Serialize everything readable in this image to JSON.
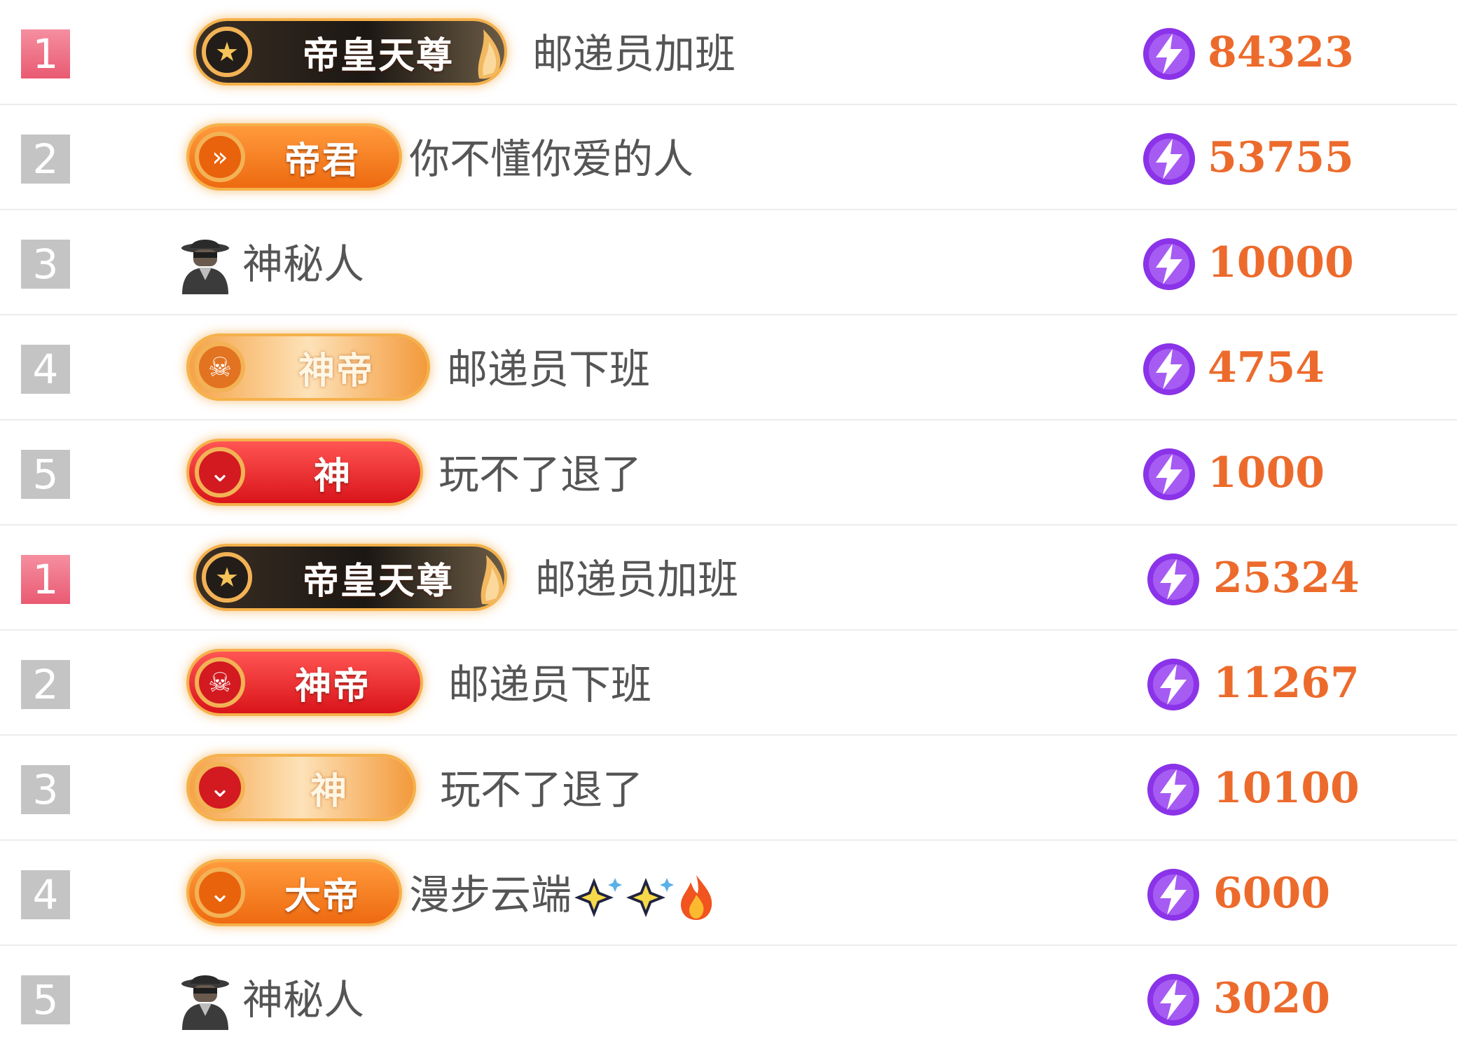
{
  "colors": {
    "rank_top": "#e95a72",
    "rank_other": "#c4c4c4",
    "score": "#ec6b2c",
    "bolt": "#8a33e8",
    "name": "#555555"
  },
  "rows": [
    {
      "rank": "1",
      "badge": {
        "style": "dark",
        "emblem_icon": "star-icon",
        "text": "帝皇天尊"
      },
      "name": "邮递员加班",
      "score": "84323"
    },
    {
      "rank": "2",
      "badge": {
        "style": "orange",
        "emblem_icon": "double-chevron-icon",
        "text": "帝君"
      },
      "name": "你不懂你爱的人",
      "score": "53755"
    },
    {
      "rank": "3",
      "badge": null,
      "avatar_icon": "mystery-person-icon",
      "name": "神秘人",
      "score": "10000"
    },
    {
      "rank": "4",
      "badge": {
        "style": "light",
        "emblem_icon": "skull-icon",
        "text": "神帝"
      },
      "name": "邮递员下班",
      "score": "4754"
    },
    {
      "rank": "5",
      "badge": {
        "style": "red",
        "emblem_icon": "chevron-down-icon",
        "text": "神"
      },
      "name": "玩不了退了",
      "score": "1000"
    },
    {
      "rank": "1",
      "badge": {
        "style": "dark",
        "emblem_icon": "star-icon",
        "text": "帝皇天尊"
      },
      "name": "邮递员加班",
      "score": "25324"
    },
    {
      "rank": "2",
      "badge": {
        "style": "red",
        "emblem_icon": "skull-icon",
        "text": "神帝"
      },
      "name": "邮递员下班",
      "score": "11267"
    },
    {
      "rank": "3",
      "badge": {
        "style": "light",
        "emblem_icon": "chevron-down-icon",
        "text": "神"
      },
      "name": "玩不了退了",
      "score": "10100"
    },
    {
      "rank": "4",
      "badge": {
        "style": "orange",
        "emblem_icon": "chevron-down-icon",
        "text": "大帝"
      },
      "name": "漫步云端",
      "name_emojis": [
        "sparkles-icon",
        "sparkles-icon",
        "fire-icon"
      ],
      "score": "6000"
    },
    {
      "rank": "5",
      "badge": null,
      "avatar_icon": "mystery-person-icon",
      "name": "神秘人",
      "score": "3020"
    }
  ]
}
